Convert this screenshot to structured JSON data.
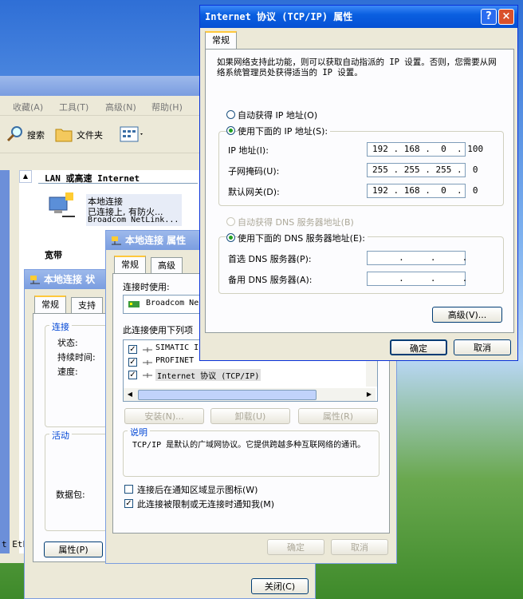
{
  "explorer": {
    "menu": [
      "收藏(A)",
      "工具(T)",
      "高级(N)",
      "帮助(H)"
    ],
    "toolbar_search": "搜索",
    "toolbar_folders": "文件夹",
    "section_lan": "LAN 或高速 Internet",
    "conn_name": "本地连接",
    "conn_status": "已连接上, 有防火...",
    "conn_adapter": "Broadcom NetLink...",
    "section_broadband": "宽带",
    "bottom_text": "t Eth"
  },
  "status_dialog": {
    "title": "本地连接 状",
    "tabs": [
      "常规",
      "支持"
    ],
    "group_conn": "连接",
    "fields": [
      "状态:",
      "持续时间:",
      "速度:"
    ],
    "group_activity": "活动",
    "packets_label": "数据包:",
    "properties_btn": "属性(P)",
    "close_btn": "关闭(C)"
  },
  "prop_dialog": {
    "title": "本地连接 属性",
    "tabs": [
      "常规",
      "高级"
    ],
    "connect_using": "连接时使用:",
    "adapter": "Broadcom Ne",
    "items_label": "此连接使用下列项",
    "items": [
      "SIMATIC I",
      "PROFINET",
      "Internet 协议 (TCP/IP)"
    ],
    "install_btn": "安装(N)...",
    "uninstall_btn": "卸载(U)",
    "properties_btn": "属性(R)",
    "desc_group": "说明",
    "desc_text": "TCP/IP 是默认的广域网协议。它提供跨越多种互联网络的通讯。",
    "chk_show_icon": "连接后在通知区域显示图标(W)",
    "chk_notify": "此连接被限制或无连接时通知我(M)",
    "ok_btn": "确定",
    "cancel_btn": "取消"
  },
  "tcpip_dialog": {
    "title": "Internet 协议 (TCP/IP) 属性",
    "help_btn": "?",
    "close_btn": "×",
    "tab": "常规",
    "intro": "如果网络支持此功能，则可以获取自动指派的 IP 设置。否则，您需要从网络系统管理员处获得适当的 IP 设置。",
    "auto_ip": "自动获得 IP 地址(O)",
    "use_ip": "使用下面的 IP 地址(S):",
    "ip_label": "IP 地址(I):",
    "ip_value": "192 . 168 .  0  . 100",
    "mask_label": "子网掩码(U):",
    "mask_value": "255 . 255 . 255 .  0",
    "gw_label": "默认网关(D):",
    "gw_value": "192 . 168 .  0  .  0",
    "auto_dns": "自动获得 DNS 服务器地址(B)",
    "use_dns": "使用下面的 DNS 服务器地址(E):",
    "dns1_label": "首选 DNS 服务器(P):",
    "dns2_label": "备用 DNS 服务器(A):",
    "empty_ip": "     .     .     .",
    "advanced_btn": "高级(V)...",
    "ok_btn": "确定",
    "cancel_btn": "取消"
  }
}
